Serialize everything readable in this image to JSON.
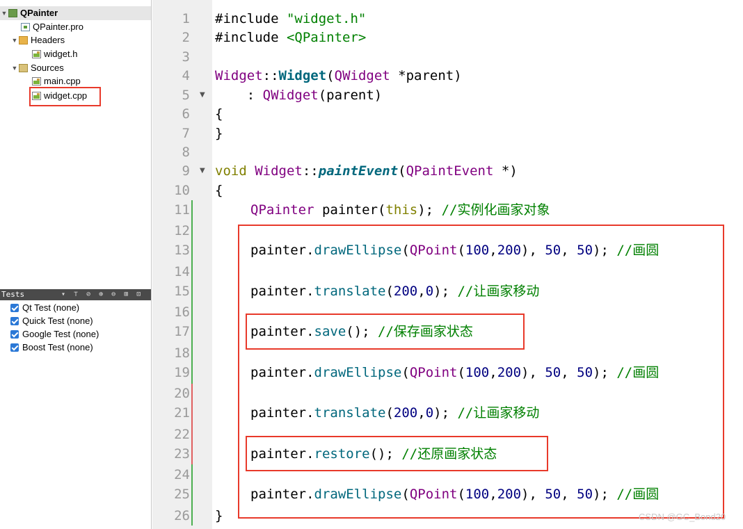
{
  "project_tree": {
    "root": "QPainter",
    "pro_file": "QPainter.pro",
    "headers_label": "Headers",
    "header_file": "widget.h",
    "sources_label": "Sources",
    "source_file_1": "main.cpp",
    "source_file_2": "widget.cpp"
  },
  "tests": {
    "title": "Tests",
    "items": [
      "Qt Test (none)",
      "Quick Test (none)",
      "Google Test (none)",
      "Boost Test (none)"
    ]
  },
  "editor": {
    "line_numbers": [
      "1",
      "2",
      "3",
      "4",
      "5",
      "6",
      "7",
      "8",
      "9",
      "10",
      "11",
      "12",
      "13",
      "14",
      "15",
      "16",
      "17",
      "18",
      "19",
      "20",
      "21",
      "22",
      "23",
      "24",
      "25",
      "26"
    ],
    "code": {
      "l1_directive": "#include",
      "l1_file": "\"widget.h\"",
      "l2_directive": "#include",
      "l2_file": "<QPainter>",
      "l4_class": "Widget",
      "l4_sep": "::",
      "l4_ctor": "Widget",
      "l4_args_open": "(",
      "l4_param_type": "QWidget",
      "l4_param": " *parent)",
      "l5_init": "    : ",
      "l5_base": "QWidget",
      "l5_rest": "(parent)",
      "l6": "{",
      "l7": "}",
      "l9_kw": "void",
      "l9_class": "Widget",
      "l9_sep": "::",
      "l9_fn": "paintEvent",
      "l9_paren": "(",
      "l9_type": "QPaintEvent",
      "l9_rest": " *)",
      "l10": "{",
      "l11_type": "QPainter",
      "l11_var": " painter(",
      "l11_this": "this",
      "l11_end": "); ",
      "l11_comment": "//实例化画家对象",
      "l13_obj": "painter.",
      "l13_fn": "drawEllipse",
      "l13_open": "(",
      "l13_cls": "QPoint",
      "l13_args_a": "(",
      "l13_n1": "100",
      "l13_comma1": ",",
      "l13_n2": "200",
      "l13_args_b": "), ",
      "l13_n3": "50",
      "l13_comma2": ", ",
      "l13_n4": "50",
      "l13_end": "); ",
      "l13_comment": "//画圆",
      "l15_obj": "painter.",
      "l15_fn": "translate",
      "l15_open": "(",
      "l15_n1": "200",
      "l15_comma": ",",
      "l15_n2": "0",
      "l15_end": "); ",
      "l15_comment": "//让画家移动",
      "l17_obj": "painter.",
      "l17_fn": "save",
      "l17_end": "(); ",
      "l17_comment": "//保存画家状态",
      "l19_obj": "painter.",
      "l19_fn": "drawEllipse",
      "l19_open": "(",
      "l19_cls": "QPoint",
      "l19_args_a": "(",
      "l19_n1": "100",
      "l19_comma1": ",",
      "l19_n2": "200",
      "l19_args_b": "), ",
      "l19_n3": "50",
      "l19_comma2": ", ",
      "l19_n4": "50",
      "l19_end": "); ",
      "l19_comment": "//画圆",
      "l21_obj": "painter.",
      "l21_fn": "translate",
      "l21_open": "(",
      "l21_n1": "200",
      "l21_comma": ",",
      "l21_n2": "0",
      "l21_end": "); ",
      "l21_comment": "//让画家移动",
      "l23_obj": "painter.",
      "l23_fn": "restore",
      "l23_end": "(); ",
      "l23_comment": "//还原画家状态",
      "l25_obj": "painter.",
      "l25_fn": "drawEllipse",
      "l25_open": "(",
      "l25_cls": "QPoint",
      "l25_args_a": "(",
      "l25_n1": "100",
      "l25_comma1": ",",
      "l25_n2": "200",
      "l25_args_b": "), ",
      "l25_n3": "50",
      "l25_comma2": ", ",
      "l25_n4": "50",
      "l25_end": "); ",
      "l25_comment": "//画圆",
      "l26": "}"
    }
  },
  "watermark": "CSDN @GC_Bond20",
  "colors": {
    "highlight_box": "#e8392a",
    "keyword": "#808000",
    "class": "#800080",
    "string": "#008000",
    "number": "#000080",
    "function": "#00677c",
    "comment": "#008000"
  }
}
